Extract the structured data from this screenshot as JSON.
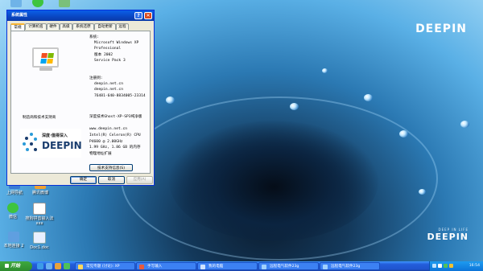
{
  "desktop": {
    "brand_top": "DEEPIN",
    "brand_bottom_small": "DEEP IN LIFE",
    "brand_bottom": "DEEPIN",
    "icons": [
      {
        "label": "上网导航",
        "icon": "browser-icon",
        "color": "#3a7bd5"
      },
      {
        "label": "腾讯微博",
        "icon": "weibo-icon",
        "color": "#f0a030"
      },
      {
        "label": "微信",
        "icon": "wechat-icon",
        "color": "#3ec43e"
      },
      {
        "label": "搜狗拼音输入法 xxx",
        "icon": "sogou-icon",
        "color": "#ffffff"
      },
      {
        "label": "本地连接 2",
        "icon": "network-icon",
        "color": "#5f9fe0"
      },
      {
        "label": "Doc1.doc",
        "icon": "doc-icon",
        "color": "#e8f0ff"
      }
    ]
  },
  "dialog": {
    "title": "系统属性",
    "tabs": [
      "常规",
      "计算机名",
      "硬件",
      "高级",
      "系统还原",
      "自动更新",
      "远程"
    ],
    "system_heading": "系统:",
    "system_lines": [
      "Microsoft Windows XP",
      "Professional",
      "版本 2002",
      "Service Pack 3"
    ],
    "registered_heading": "注册到:",
    "registered_lines": [
      "deepin.net.cn",
      "deepin.net.cn",
      "76481-640-8834005-23314"
    ],
    "manufacturer_line": "深度技术Ghost-XP-SP3纯净版",
    "computer_lines": [
      "www.deepin.net.cn",
      "Intel(R) Celeron(R) CPU",
      "P4600 @ 2.00GHz",
      "1.99 GHz, 1.86 GB 的内存",
      "物理地址扩展"
    ],
    "manufacturer_support": "制造商和技术支持商",
    "logo_cn": "深度·值得深入",
    "logo_en": "DEEPIN",
    "support_button": "技术支持信息(S)",
    "ok": "确定",
    "cancel": "取消",
    "apply": "应用(A)",
    "help_glyph": "?",
    "close_glyph": "✕"
  },
  "taskbar": {
    "start": "开始",
    "tasks": [
      "常见专题 (讨论): XP",
      "手写输入",
      "我的电脑",
      "远程电气软件23g",
      "远程电气软件23g"
    ],
    "clock": "16:54"
  }
}
